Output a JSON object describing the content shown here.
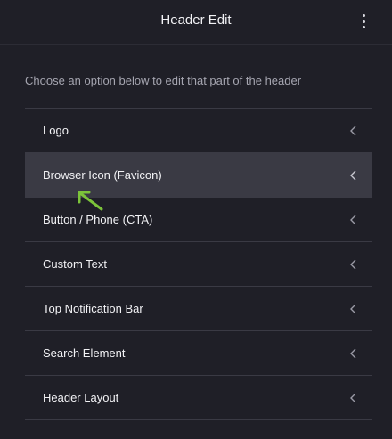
{
  "header": {
    "title": "Header Edit",
    "menu_icon": "kebab-menu-icon"
  },
  "intro": "Choose an option below to edit that part of the header",
  "items": [
    {
      "label": "Logo"
    },
    {
      "label": "Browser Icon (Favicon)"
    },
    {
      "label": "Button / Phone (CTA)"
    },
    {
      "label": "Custom Text"
    },
    {
      "label": "Top Notification Bar"
    },
    {
      "label": "Search Element"
    },
    {
      "label": "Header Layout"
    }
  ],
  "colors": {
    "background": "#1f1f27",
    "hover_row": "#3a3a44",
    "divider": "#3a3a44",
    "pointer": "#7cc43a"
  }
}
